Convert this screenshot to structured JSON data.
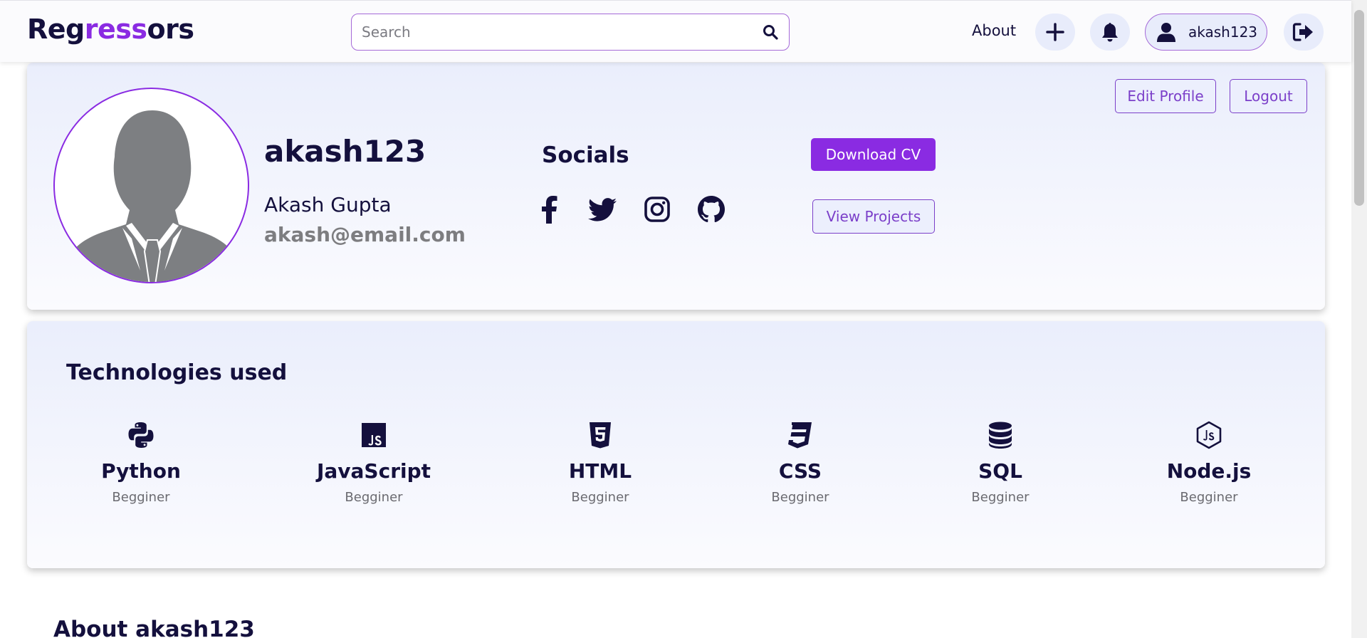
{
  "navbar": {
    "brand_start": "Reg",
    "brand_mid": "ress",
    "brand_end": "ors",
    "search_placeholder": "Search",
    "about_label": "About",
    "username": "akash123"
  },
  "profile": {
    "username": "akash123",
    "full_name": "Akash Gupta",
    "email": "akash@email.com",
    "socials_title": "Socials",
    "socials": [
      "facebook-icon",
      "twitter-icon",
      "instagram-icon",
      "github-icon"
    ],
    "edit_profile_label": "Edit Profile",
    "logout_label": "Logout",
    "download_cv_label": "Download CV",
    "view_projects_label": "View Projects"
  },
  "technologies": {
    "title": "Technologies used",
    "items": [
      {
        "name": "Python",
        "level": "Begginer",
        "icon": "python-icon"
      },
      {
        "name": "JavaScript",
        "level": "Begginer",
        "icon": "javascript-icon"
      },
      {
        "name": "HTML",
        "level": "Begginer",
        "icon": "html5-icon"
      },
      {
        "name": "CSS",
        "level": "Begginer",
        "icon": "css3-icon"
      },
      {
        "name": "SQL",
        "level": "Begginer",
        "icon": "database-icon"
      },
      {
        "name": "Node.js",
        "level": "Begginer",
        "icon": "nodejs-icon"
      }
    ]
  },
  "about": {
    "title": "About akash123"
  },
  "colors": {
    "accent": "#8a2be2",
    "text_dark": "#14103d",
    "muted": "#7d7d80",
    "pill_bg": "#e8ecfb"
  }
}
